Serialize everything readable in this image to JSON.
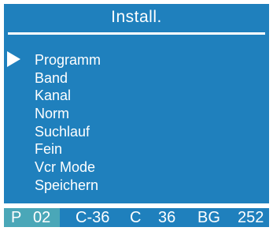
{
  "header": {
    "title": "Install."
  },
  "menu": {
    "selected_index": 0,
    "items": [
      {
        "label": "Programm"
      },
      {
        "label": "Band"
      },
      {
        "label": "Kanal"
      },
      {
        "label": "Norm"
      },
      {
        "label": "Suchlauf"
      },
      {
        "label": "Fein"
      },
      {
        "label": "Vcr Mode"
      },
      {
        "label": "Speichern"
      }
    ]
  },
  "status": {
    "program_prefix": "P",
    "program_number": "02",
    "channel_code": "C-36",
    "band_letter": "C",
    "channel_number": "36",
    "norm": "BG",
    "fine_value": "252"
  },
  "colors": {
    "background": "#1f80bd",
    "highlight": "#4aa7b8",
    "text": "#ffffff"
  }
}
